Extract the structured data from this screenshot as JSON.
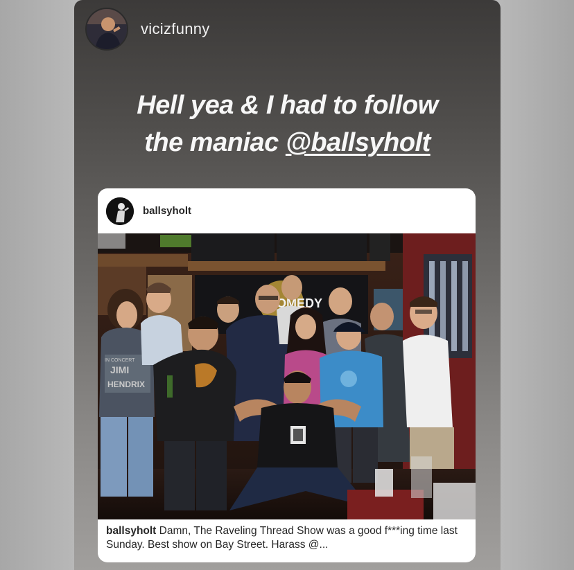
{
  "story": {
    "username": "vicizfunny",
    "caption_line1": "Hell yea & I had to follow",
    "caption_line2_prefix": "the maniac ",
    "caption_mention": "@ballsyholt"
  },
  "shared_post": {
    "username": "ballsyholt",
    "caption_username": "ballsyholt",
    "caption_text": " Damn, The Raveling Thread Show was a good f***ing time last Sunday. Best show on Bay Street. Harass @...",
    "photo_alt": "Group photo of comedians in a bar"
  },
  "photo_details": {
    "shirt_text": [
      "JIMI",
      "HENDRIX",
      "IN CONCERT"
    ],
    "banner_text": "COMEDY"
  },
  "colors": {
    "story_bg_top": "#3c3a39",
    "story_bg_bottom": "#a19f9d",
    "card_bg": "#ffffff",
    "text_light": "#f7f7f7",
    "text_dark": "#262626"
  }
}
